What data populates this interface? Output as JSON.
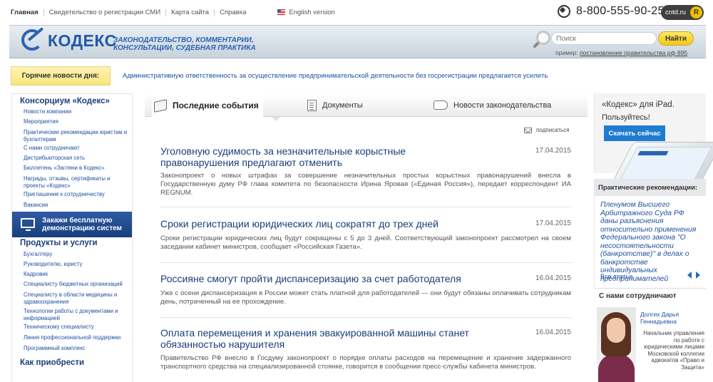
{
  "toplinks": [
    "Главная",
    "Свидетельство о регистрации СМИ",
    "Карта сайта",
    "Справка"
  ],
  "english": "English version",
  "phone": "8-800-555-90-25",
  "cntd": "cntd.ru",
  "cntd_r": "R",
  "logo": "КОДЕКС",
  "slogan": [
    "ЗАКОНОДАТЕЛЬСТВО, КОММЕНТАРИИ,",
    "КОНСУЛЬТАЦИИ, СУДЕБНАЯ ПРАКТИКА"
  ],
  "search": {
    "placeholder": "Поиск",
    "button": "Найти",
    "example_prefix": "пример: ",
    "example_link": "постановление правительства рф 895"
  },
  "hot": {
    "label": "Горячие новости дня:",
    "text": "Административную ответственность за осуществление предпринимательской деятельности без госрегистрации предлагается усилить"
  },
  "left": {
    "consortium_title": "Консорциум «Кодекс»",
    "consortium_links": [
      "Новости компании",
      "Мероприятия",
      "Практические рекомендации юристам и бухгалтерам",
      "С нами сотрудничают",
      "Дистрибьюторская сеть",
      "Бюллетень «Загляни в Кодекс»",
      "Награды, отзывы, сертификаты и проекты «Кодекс»",
      "Приглашение к сотрудничеству",
      "Вакансии"
    ],
    "promo": "Закажи бесплатную демонстрацию систем",
    "products_title": "Продукты и услуги",
    "products_links": [
      "Бухгалтеру",
      "Руководителю, юристу",
      "Кадровик",
      "Специалисту бюджетных организаций",
      "Специалисту в области медицины и здравоохранения",
      "Технологии работы с документами и информацией",
      "Техническому специалисту",
      "Линия профессиональной поддержки",
      "Программный комплекс"
    ],
    "buy_title": "Как приобрести"
  },
  "tabs": [
    "Последние события",
    "Документы",
    "Новости законодательства"
  ],
  "subscribe": "подписаться",
  "news": [
    {
      "title": "Уголовную судимость за незначительные корыстные правонарушения предлагают отменить",
      "date": "17.04.2015",
      "body": "Законопроект о новых штрафах за совершение незначительных простых корыстных правонарушений внесла в Государственную думу РФ глава комитета по безопасности Ирина Яровая («Единая Россия»), передает корреспондент ИА REGNUM."
    },
    {
      "title": "Сроки регистрации юридических лиц сократят до трех дней",
      "date": "17.04.2015",
      "body": "Сроки регистрации юридических лиц будут сокращены с 5 до 3 дней. Соответствующий законопроект рассмотрел на своем заседании кабинет министров, сообщает «Российская Газета»."
    },
    {
      "title": "Россияне смогут пройти диспансеризацию за счет работодателя",
      "date": "16.04.2015",
      "body": "Уже с осени диспансеризация в России может стать платной для работодателей — они будут обязаны оплачивать сотрудникам день, потраченный на ее прохождение."
    },
    {
      "title": "Оплата перемещения и хранения эвакуированной машины станет обязанностью нарушителя",
      "date": "16.04.2015",
      "body": "Правительство РФ внесло в Госдуму законопроект о порядке оплаты расходов на перемещение и хранение задержанного транспортного средства на специализированной стоянке, говорится в сообщении пресс-службы кабинета министров."
    }
  ],
  "right": {
    "ipad_title": "«Кодекс» для iPad.",
    "ipad_sub": "Пользуйтесь!",
    "ipad_btn": "Скачать сейчас",
    "rec_head": "Практические рекомендации:",
    "rec_text": "Пленумом Высшего Арбитражного Суда РФ даны разъяснения относительно применения Федерального закона \"О несостоятельности (банкротстве)\" в делах о банкротстве индивидуальных предпринимателей",
    "rec_all": "Все статьи",
    "staff_head": "С нами сотрудничают",
    "staff_name": "Долгих Дарья Геннадьевна",
    "staff_desc": "Начальник управления по работе с юридическими лицами Московской коллегии адвокатов «Право и Защита»"
  }
}
